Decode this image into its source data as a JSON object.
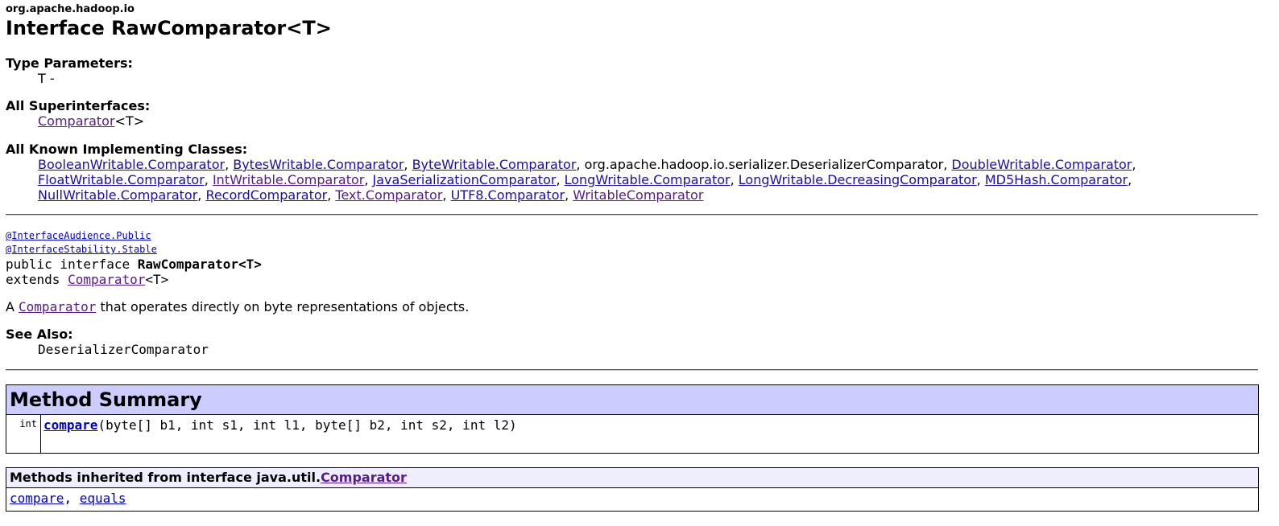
{
  "package_name": "org.apache.hadoop.io",
  "title": "Interface RawComparator<T>",
  "type_parameters": {
    "label": "Type Parameters:",
    "value": "T -"
  },
  "superinterfaces": {
    "label": "All Superinterfaces:",
    "link": "Comparator",
    "suffix": "<T>"
  },
  "implementing_classes": {
    "label": "All Known Implementing Classes:",
    "items": [
      {
        "text": "BooleanWritable.Comparator",
        "link": true,
        "visited": false
      },
      {
        "text": "BytesWritable.Comparator",
        "link": true,
        "visited": false
      },
      {
        "text": "ByteWritable.Comparator",
        "link": true,
        "visited": false
      },
      {
        "text": "org.apache.hadoop.io.serializer.DeserializerComparator",
        "link": false,
        "visited": false
      },
      {
        "text": "DoubleWritable.Comparator",
        "link": true,
        "visited": false
      },
      {
        "text": "FloatWritable.Comparator",
        "link": true,
        "visited": false
      },
      {
        "text": "IntWritable.Comparator",
        "link": true,
        "visited": true
      },
      {
        "text": "JavaSerializationComparator",
        "link": true,
        "visited": false
      },
      {
        "text": "LongWritable.Comparator",
        "link": true,
        "visited": false
      },
      {
        "text": "LongWritable.DecreasingComparator",
        "link": true,
        "visited": false
      },
      {
        "text": "MD5Hash.Comparator",
        "link": true,
        "visited": false
      },
      {
        "text": "NullWritable.Comparator",
        "link": true,
        "visited": false
      },
      {
        "text": "RecordComparator",
        "link": true,
        "visited": false
      },
      {
        "text": "Text.Comparator",
        "link": true,
        "visited": true
      },
      {
        "text": "UTF8.Comparator",
        "link": true,
        "visited": false
      },
      {
        "text": "WritableComparator",
        "link": true,
        "visited": true
      }
    ]
  },
  "annotations": [
    "@InterfaceAudience.Public",
    "@InterfaceStability.Stable"
  ],
  "declaration": {
    "prefix": "public interface ",
    "name": "RawComparator<T>",
    "extends_prefix": "extends ",
    "extends_link": "Comparator",
    "extends_suffix": "<T>"
  },
  "description": {
    "prefix": "A ",
    "link": "Comparator",
    "suffix": " that operates directly on byte representations of objects."
  },
  "see_also": {
    "label": "See Also:",
    "value": "DeserializerComparator"
  },
  "method_summary": {
    "heading": "Method Summary",
    "rows": [
      {
        "type": "int",
        "name": "compare",
        "params": "(byte[] b1, int s1, int l1, byte[] b2, int s2, int l2)"
      }
    ]
  },
  "inherited": {
    "heading_prefix": "Methods inherited from interface java.util.",
    "heading_link": "Comparator",
    "methods": [
      "compare",
      "equals"
    ],
    "separator": ", "
  },
  "colors": {
    "link": "#1a0dab",
    "visited_link": "#551a8b",
    "summary_header_bg": "#ccccff",
    "inherited_header_bg": "#eeeeff"
  }
}
